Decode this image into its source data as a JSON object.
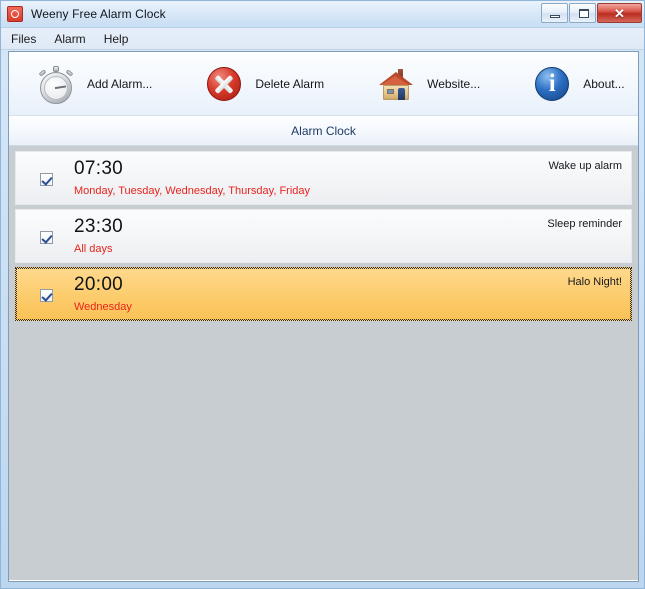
{
  "window": {
    "title": "Weeny Free Alarm Clock",
    "app_icon": "alarm-clock-icon",
    "controls": {
      "minimize": "minimize-icon",
      "maximize": "maximize-icon",
      "close": "✕"
    }
  },
  "menubar": {
    "items": [
      {
        "label": "Files"
      },
      {
        "label": "Alarm"
      },
      {
        "label": "Help"
      }
    ]
  },
  "toolbar": {
    "buttons": [
      {
        "label": "Add Alarm...",
        "icon": "stopwatch-icon"
      },
      {
        "label": "Delete Alarm",
        "icon": "delete-circle-icon"
      },
      {
        "label": "Website...",
        "icon": "house-icon"
      },
      {
        "label": "About...",
        "icon": "info-circle-icon"
      }
    ]
  },
  "section": {
    "title": "Alarm  Clock"
  },
  "alarms": [
    {
      "time": "07:30",
      "label": "Wake up alarm",
      "days": "Monday, Tuesday, Wednesday, Thursday, Friday",
      "enabled": true,
      "selected": false
    },
    {
      "time": "23:30",
      "label": "Sleep reminder",
      "days": "All days",
      "enabled": true,
      "selected": false
    },
    {
      "time": "20:00",
      "label": "Halo Night!",
      "days": "Wednesday",
      "enabled": true,
      "selected": true
    }
  ],
  "colors": {
    "selection": "#fbc95f",
    "days_text": "#e8241c",
    "header_text": "#1f3b63",
    "list_background": "#c8cdd2"
  }
}
